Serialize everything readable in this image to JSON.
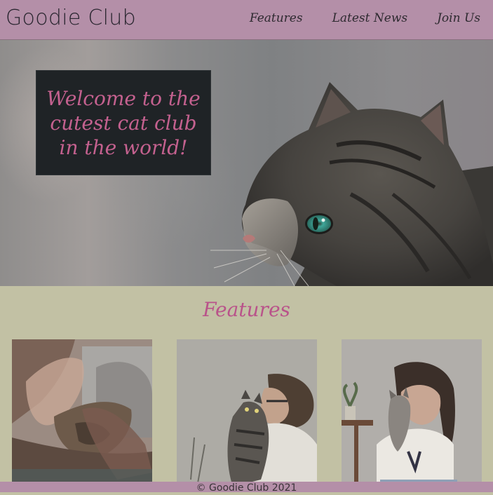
{
  "header": {
    "brand": "Goodie Club",
    "nav": [
      {
        "label": "Features"
      },
      {
        "label": "Latest News"
      },
      {
        "label": "Join Us"
      }
    ]
  },
  "hero": {
    "welcome_line1": "Welcome to the",
    "welcome_line2": "cutest cat club",
    "welcome_line3": "in the world!",
    "image": "tabby-cat-photo"
  },
  "features": {
    "title": "Features",
    "cards": [
      {
        "image": "high-five-cat-paw-photo"
      },
      {
        "image": "woman-holding-cat-photo"
      },
      {
        "image": "girl-kissing-kitten-photo"
      }
    ]
  },
  "footer": {
    "text": "© Goodie Club 2021"
  },
  "colors": {
    "header_bg": "#b48fa8",
    "page_bg": "#c2c1a4",
    "accent_pink": "#c4618f",
    "welcome_box_bg": "#1f2326"
  }
}
